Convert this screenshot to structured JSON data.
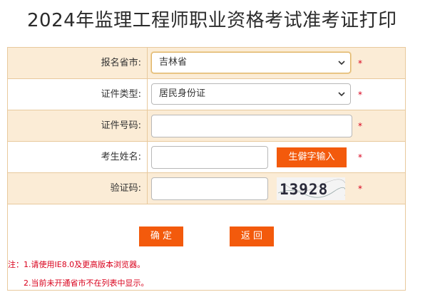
{
  "page": {
    "title": "2024年监理工程师职业资格考试准考证打印"
  },
  "form": {
    "province": {
      "label": "报名省市:",
      "value": "吉林省",
      "required": "*"
    },
    "id_type": {
      "label": "证件类型:",
      "value": "居民身份证",
      "required": "*"
    },
    "id_number": {
      "label": "证件号码:",
      "value": "",
      "required": "*"
    },
    "name": {
      "label": "考生姓名:",
      "value": "",
      "required": "*",
      "rare_char_button": "生僻字输入"
    },
    "captcha": {
      "label": "验证码:",
      "value": "",
      "required": "*",
      "image_text": "13928"
    }
  },
  "actions": {
    "confirm": "确 定",
    "back": "返 回"
  },
  "notes": {
    "line1": "注：1.请使用IE8.0及更高版本浏览器。",
    "line2": "2.当前未开通省市不在列表中显示。"
  },
  "colors": {
    "accent_button": "#f35a0c",
    "row_alt_bg": "#fbecd6",
    "border": "#e8c99d",
    "required_star": "#d9001b"
  }
}
